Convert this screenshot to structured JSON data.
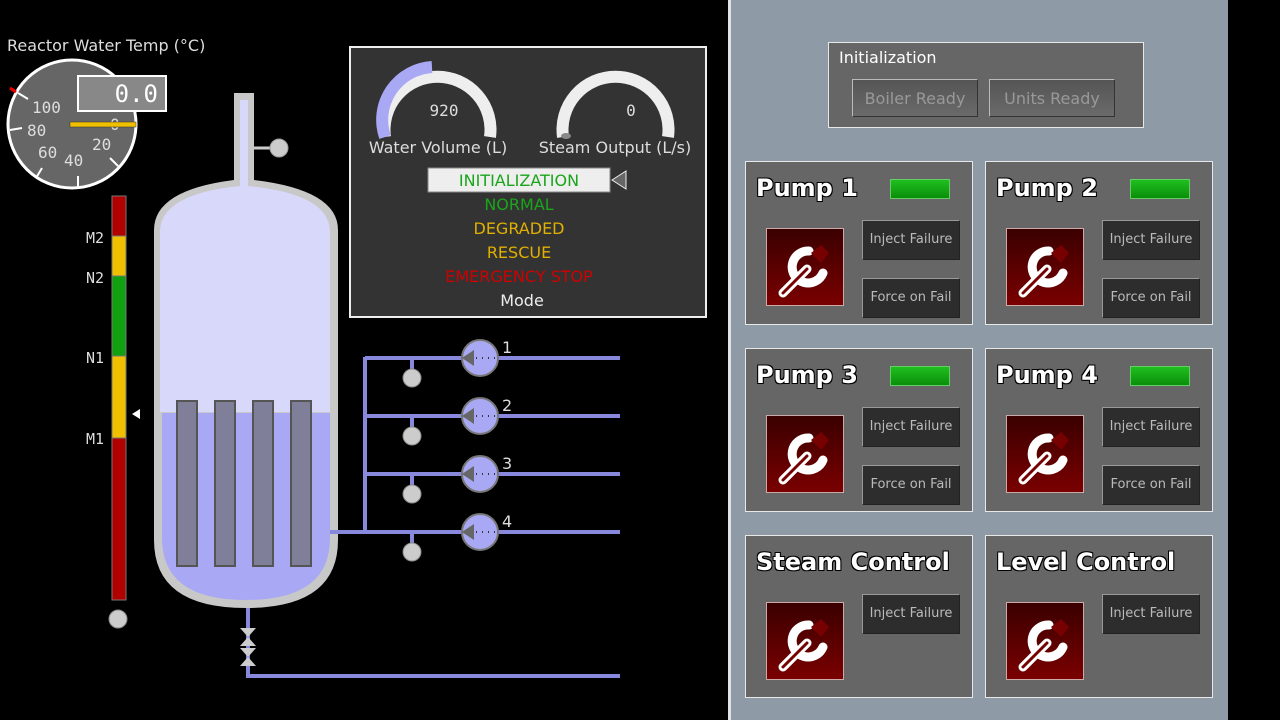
{
  "temperature": {
    "label": "Reactor Water Temp (°C)",
    "value": "0.0",
    "ticks": [
      "100",
      "80",
      "60",
      "40",
      "20",
      "0"
    ]
  },
  "level_bar": {
    "labels": [
      "M2",
      "N2",
      "N1",
      "M1"
    ]
  },
  "mode_panel": {
    "water_volume": {
      "label": "Water Volume (L)",
      "value": "920",
      "fraction": 0.3
    },
    "steam_output": {
      "label": "Steam Output (L/s)",
      "value": "0",
      "fraction": 0
    },
    "modes": [
      "INITIALIZATION",
      "NORMAL",
      "DEGRADED",
      "RESCUE",
      "EMERGENCY STOP"
    ],
    "selected_mode": "INITIALIZATION",
    "mode_label": "Mode"
  },
  "pumps": [
    "1",
    "2",
    "3",
    "4"
  ],
  "initialization": {
    "title": "Initialization",
    "boiler_ready": "Boiler Ready",
    "units_ready": "Units Ready"
  },
  "units": [
    {
      "name": "Pump 1",
      "inject": "Inject Failure",
      "force": "Force on Fail",
      "status": "ok"
    },
    {
      "name": "Pump 2",
      "inject": "Inject Failure",
      "force": "Force on Fail",
      "status": "ok"
    },
    {
      "name": "Pump 3",
      "inject": "Inject Failure",
      "force": "Force on Fail",
      "status": "ok"
    },
    {
      "name": "Pump 4",
      "inject": "Inject Failure",
      "force": "Force on Fail",
      "status": "ok"
    },
    {
      "name": "Steam Control",
      "inject": "Inject Failure"
    },
    {
      "name": "Level Control",
      "inject": "Inject Failure"
    }
  ],
  "colors": {
    "water": "#a8a8f5",
    "ok": "#1fbf1f",
    "normal": "#1aa51a",
    "degraded": "#e0b000",
    "emergency": "#d00000"
  }
}
